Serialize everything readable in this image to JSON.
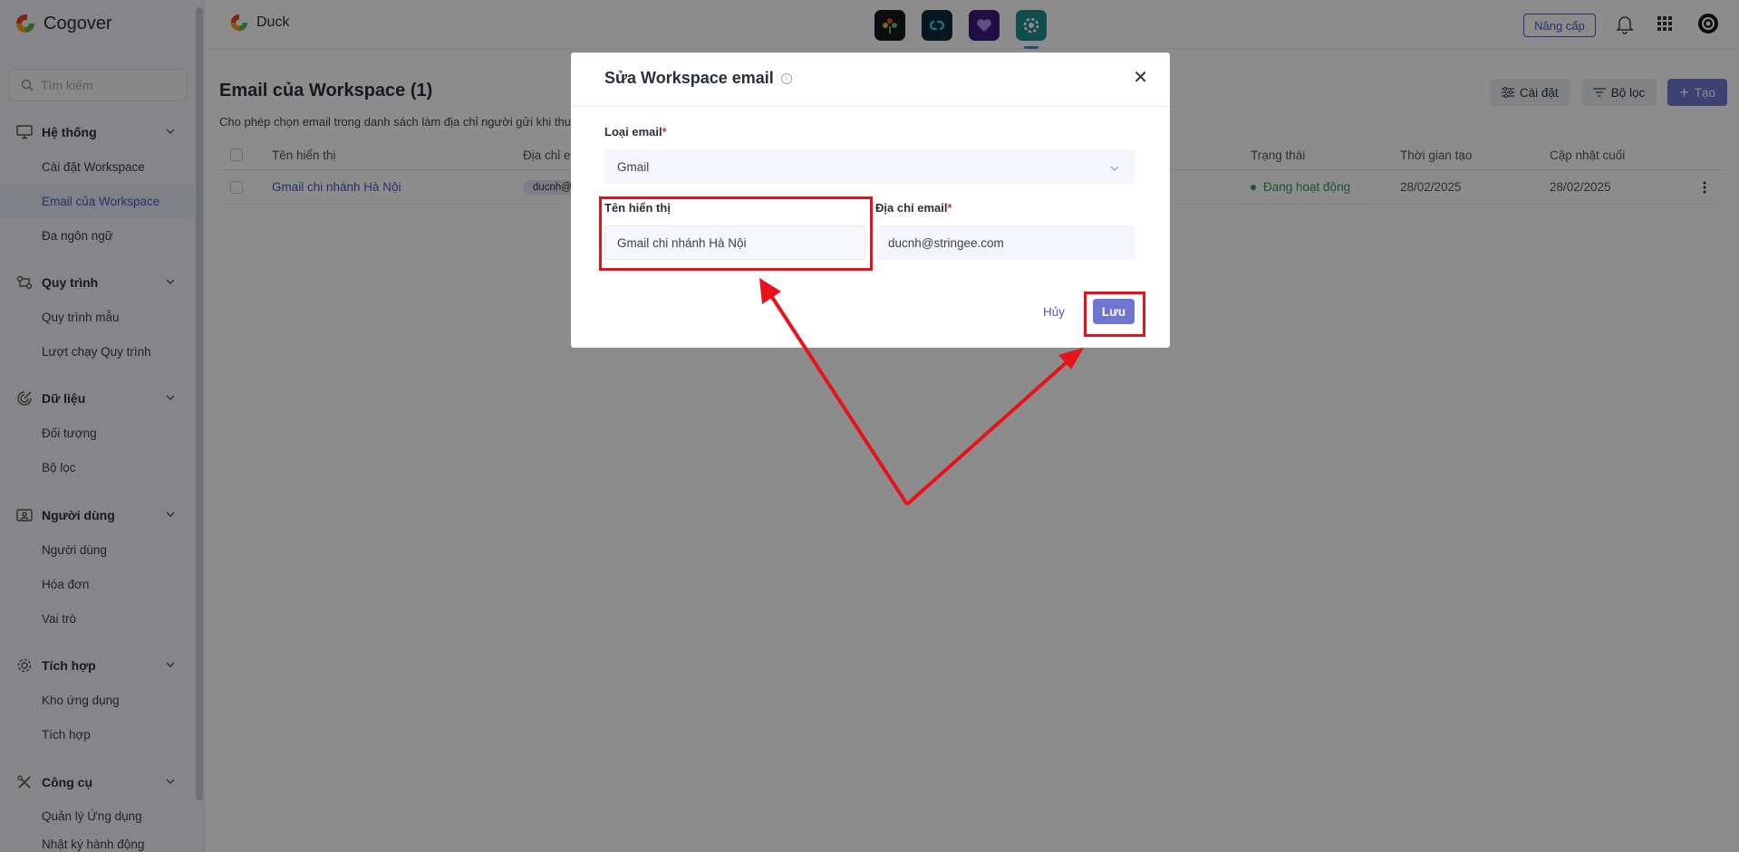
{
  "sidebar": {
    "brand": "Cogover",
    "search_placeholder": "Tìm kiếm",
    "groups": [
      {
        "label": "Hệ thống",
        "items": [
          {
            "label": "Cài đặt Workspace"
          },
          {
            "label": "Email của Workspace"
          },
          {
            "label": "Đa ngôn ngữ"
          }
        ]
      },
      {
        "label": "Quy trình",
        "items": [
          {
            "label": "Quy trình mẫu"
          },
          {
            "label": "Lượt chạy Quy trình"
          }
        ]
      },
      {
        "label": "Dữ liệu",
        "items": [
          {
            "label": "Đối tượng"
          },
          {
            "label": "Bộ lọc"
          }
        ]
      },
      {
        "label": "Người dùng",
        "items": [
          {
            "label": "Người dùng"
          },
          {
            "label": "Hóa đơn"
          },
          {
            "label": "Vai trò"
          }
        ]
      },
      {
        "label": "Tích hợp",
        "items": [
          {
            "label": "Kho ứng dụng"
          },
          {
            "label": "Tích hợp"
          }
        ]
      },
      {
        "label": "Công cụ",
        "items": [
          {
            "label": "Quản lý Ứng dụng"
          },
          {
            "label": "Nhật ký hành động"
          }
        ]
      }
    ]
  },
  "topbar": {
    "workspace": "Duck",
    "upgrade_label": "Nâng cấp"
  },
  "main": {
    "title": "Email của Workspace (1)",
    "description": "Cho phép chọn email trong danh sách làm địa chỉ người gửi khi thu",
    "actions": {
      "settings": "Cài đặt",
      "filter": "Bộ lọc",
      "create": "Tạo"
    },
    "table": {
      "headers": {
        "name": "Tên hiển thị",
        "email": "Địa chỉ e",
        "status": "Trạng thái",
        "created": "Thời gian tạo",
        "updated": "Cập nhật cuối"
      },
      "rows": [
        {
          "name": "Gmail chi nhánh Hà Nội",
          "email": "ducnh@",
          "status": "Đang hoạt động",
          "created": "28/02/2025",
          "updated": "28/02/2025"
        }
      ]
    }
  },
  "modal": {
    "title": "Sửa Workspace email",
    "email_type_label": "Loại email",
    "required_mark": "*",
    "email_type_value": "Gmail",
    "display_name_label": "Tên hiển thị",
    "display_name_value": "Gmail chi nhánh Hà Nội",
    "email_address_label": "Địa chỉ email",
    "email_address_value": "ducnh@stringee.com",
    "cancel_label": "Hủy",
    "save_label": "Lưu"
  },
  "colors": {
    "accent": "#4b57c6",
    "primary_button": "#6e76d1",
    "annotation": "#e8121b",
    "status_active": "#2e9a5a"
  }
}
